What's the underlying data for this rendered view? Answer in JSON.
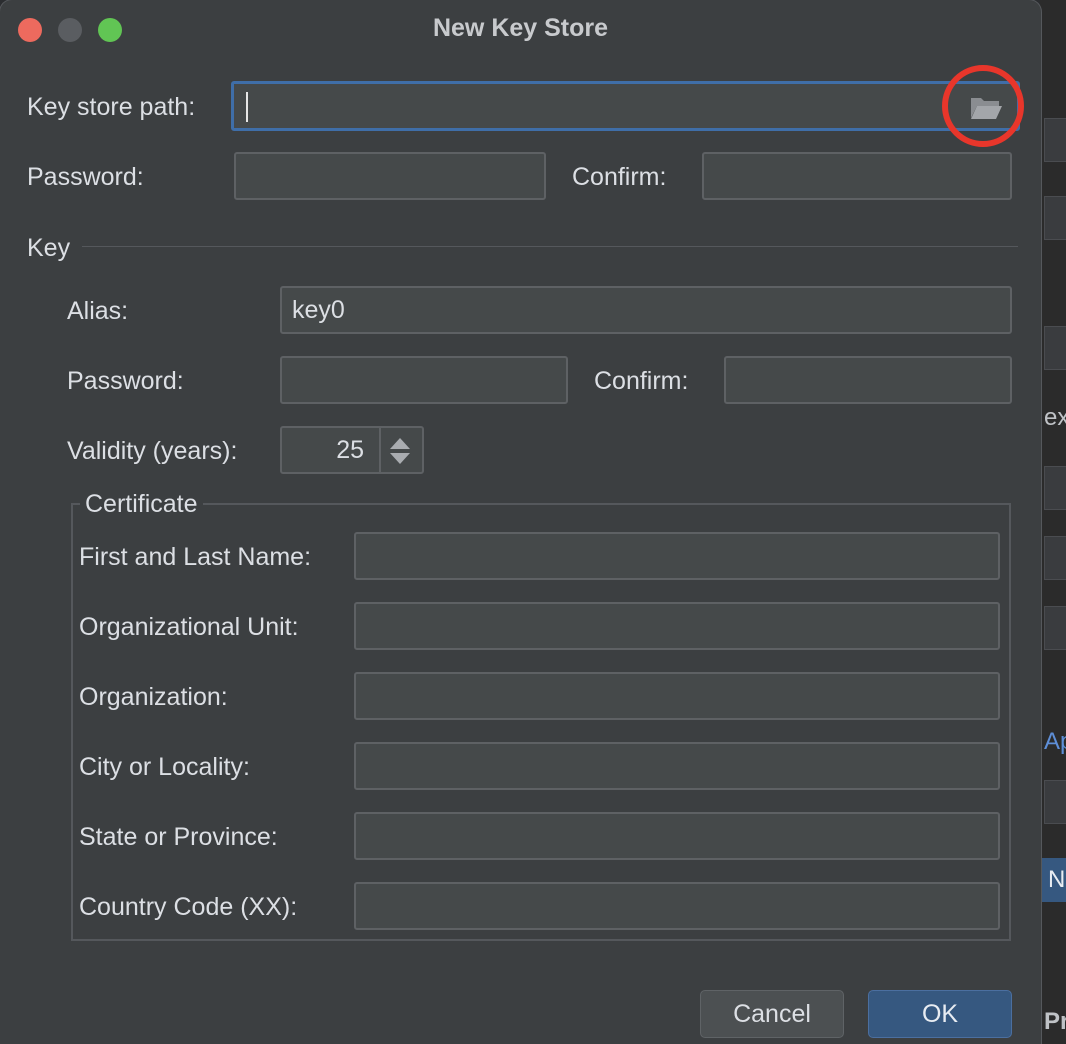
{
  "window": {
    "title": "New Key Store"
  },
  "keystore": {
    "path_label": "Key store path:",
    "path_value": "",
    "password_label": "Password:",
    "confirm_label": "Confirm:"
  },
  "key": {
    "section_label": "Key",
    "alias_label": "Alias:",
    "alias_value": "key0",
    "password_label": "Password:",
    "confirm_label": "Confirm:",
    "validity_label": "Validity (years):",
    "validity_value": "25"
  },
  "certificate": {
    "title": "Certificate",
    "fields": [
      {
        "label": "First and Last Name:",
        "value": ""
      },
      {
        "label": "Organizational Unit:",
        "value": ""
      },
      {
        "label": "Organization:",
        "value": ""
      },
      {
        "label": "City or Locality:",
        "value": ""
      },
      {
        "label": "State or Province:",
        "value": ""
      },
      {
        "label": "Country Code (XX):",
        "value": ""
      }
    ]
  },
  "buttons": {
    "cancel": "Cancel",
    "ok": "OK"
  },
  "background_window": {
    "text_1": "exi",
    "text_2": "App",
    "text_3": "N",
    "text_4": "Pr"
  },
  "icons": {
    "browse": "folder-open-icon",
    "highlight": "highlight-ring"
  },
  "colors": {
    "accent": "#3f6ea8",
    "ok_button": "#365880",
    "highlight_ring": "#e8362b"
  }
}
